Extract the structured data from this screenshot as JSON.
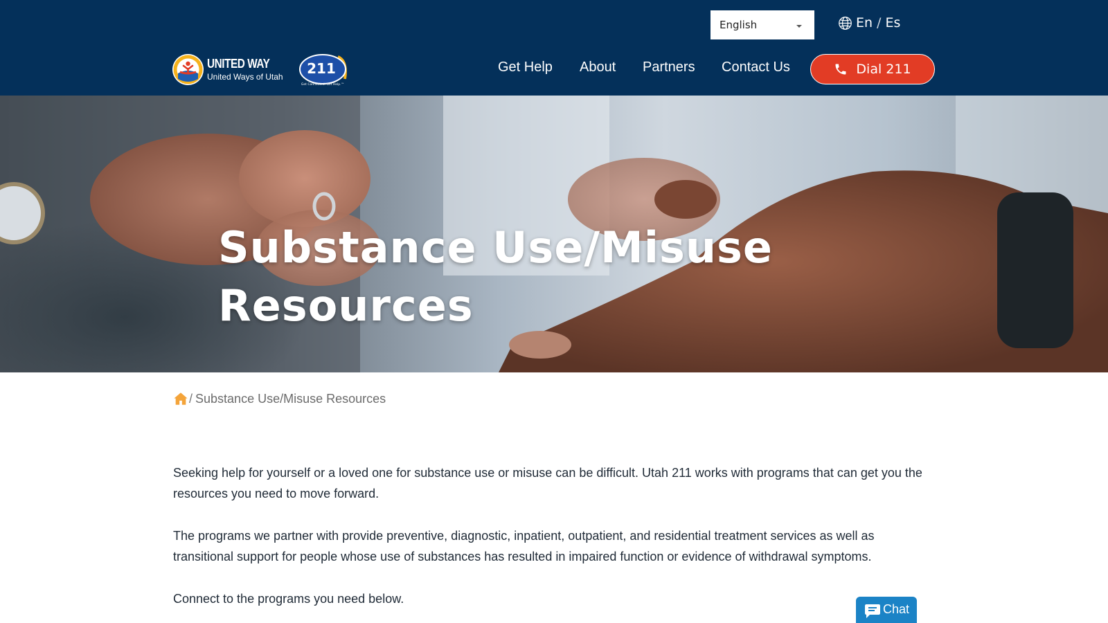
{
  "header": {
    "language_select": {
      "value": "English"
    },
    "lang_toggle": {
      "en": "En",
      "sep": "/",
      "es": "Es"
    },
    "logo_uw": {
      "title": "UNITED WAY",
      "subtitle": "United Ways of Utah"
    },
    "logo_211": {
      "number": "211",
      "tagline": "Get Connected. Get Help.™"
    },
    "nav": [
      {
        "label": "Get Help"
      },
      {
        "label": "About"
      },
      {
        "label": "Partners"
      },
      {
        "label": "Contact Us"
      }
    ],
    "dial_button": {
      "label": "Dial 211",
      "icon": "phone-icon"
    }
  },
  "hero": {
    "title_line1": "Substance Use/Misuse",
    "title_line2": "Resources"
  },
  "breadcrumb": {
    "home_icon": "home-icon",
    "separator": "/",
    "current": "Substance Use/Misuse Resources"
  },
  "content": {
    "paragraphs": [
      "Seeking help for yourself or a loved one for substance use or misuse can be difficult. Utah 211 works with programs that can get you the resources you need to move forward.",
      "The programs we partner with provide preventive, diagnostic, inpatient, outpatient, and residential treatment services as well as transitional support for people whose use of substances has resulted in impaired function or evidence of withdrawal symptoms.",
      "Connect to the programs you need below."
    ]
  },
  "chat": {
    "label": "Chat",
    "icon": "chat-bubble-icon"
  },
  "colors": {
    "header_bg": "#04305a",
    "dial_button": "#e23c25",
    "home_icon": "#f4a43a",
    "chat_button": "#1b83c6"
  }
}
